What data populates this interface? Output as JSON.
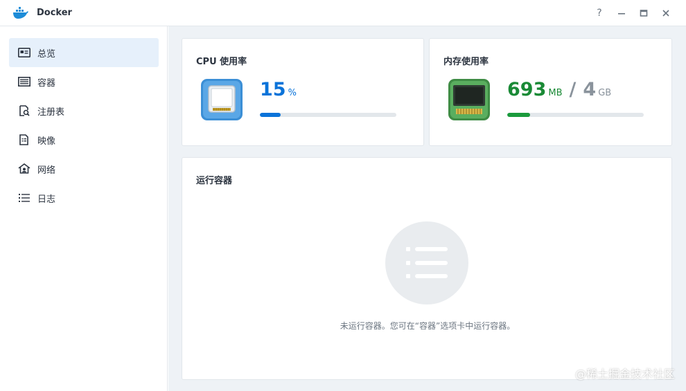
{
  "window": {
    "title": "Docker",
    "controls": {
      "help": "?",
      "minimize": "—",
      "maximize": "▭",
      "close": "✕"
    }
  },
  "sidebar": {
    "items": [
      {
        "label": "总览",
        "icon": "overview-icon",
        "active": true
      },
      {
        "label": "容器",
        "icon": "container-icon",
        "active": false
      },
      {
        "label": "注册表",
        "icon": "registry-icon",
        "active": false
      },
      {
        "label": "映像",
        "icon": "image-icon",
        "active": false
      },
      {
        "label": "网络",
        "icon": "network-icon",
        "active": false
      },
      {
        "label": "日志",
        "icon": "log-icon",
        "active": false
      }
    ]
  },
  "cpu": {
    "title": "CPU 使用率",
    "value": "15",
    "unit": "%",
    "percent": 15,
    "color": "#0a73d9"
  },
  "memory": {
    "title": "内存使用率",
    "used": "693",
    "used_unit": "MB",
    "separator": "/",
    "total": "4",
    "total_unit": "GB",
    "percent": 17,
    "color": "#1a8a36"
  },
  "running": {
    "title": "运行容器",
    "empty_message": "未运行容器。您可在“容器”选项卡中运行容器。",
    "empty_icon": "list-icon"
  },
  "watermark": "@稀土掘金技术社区",
  "colors": {
    "accent": "#0a73d9",
    "active_bg": "#e6f0fb",
    "main_bg": "#eef2f6"
  }
}
